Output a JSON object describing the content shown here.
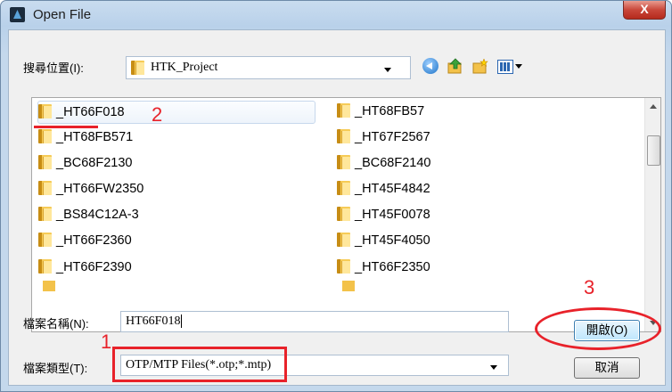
{
  "window": {
    "title": "Open File",
    "close_glyph": "X"
  },
  "lookin": {
    "label": "搜尋位置(I):",
    "value": "HTK_Project"
  },
  "toolbar": [
    "back-icon",
    "up-folder-icon",
    "new-folder-icon",
    "view-menu-icon"
  ],
  "files": [
    {
      "name": "_HT66F018",
      "selected": true
    },
    {
      "name": "_HT68FB57"
    },
    {
      "name": "_HT68FB571"
    },
    {
      "name": "_HT67F2567"
    },
    {
      "name": "_BC68F2130"
    },
    {
      "name": "_BC68F2140"
    },
    {
      "name": "_HT66FW2350"
    },
    {
      "name": "_HT45F4842"
    },
    {
      "name": "_BS84C12A-3"
    },
    {
      "name": "_HT45F0078"
    },
    {
      "name": "_HT66F2360"
    },
    {
      "name": "_HT45F4050"
    },
    {
      "name": "_HT66F2390"
    },
    {
      "name": "_HT66F2350"
    }
  ],
  "filename": {
    "label": "檔案名稱(N):",
    "value": "HT66F018"
  },
  "filetype": {
    "label": "檔案類型(T):",
    "value": "OTP/MTP Files(*.otp;*.mtp)"
  },
  "buttons": {
    "open": "開啟(O)",
    "cancel": "取消"
  },
  "annotations": {
    "step1": "1",
    "step2": "2",
    "step3": "3",
    "color": "#e8222a"
  },
  "colors": {
    "title_bar": "#b9d1ea",
    "close_button": "#c9473a",
    "selection": "#eef4fb"
  }
}
